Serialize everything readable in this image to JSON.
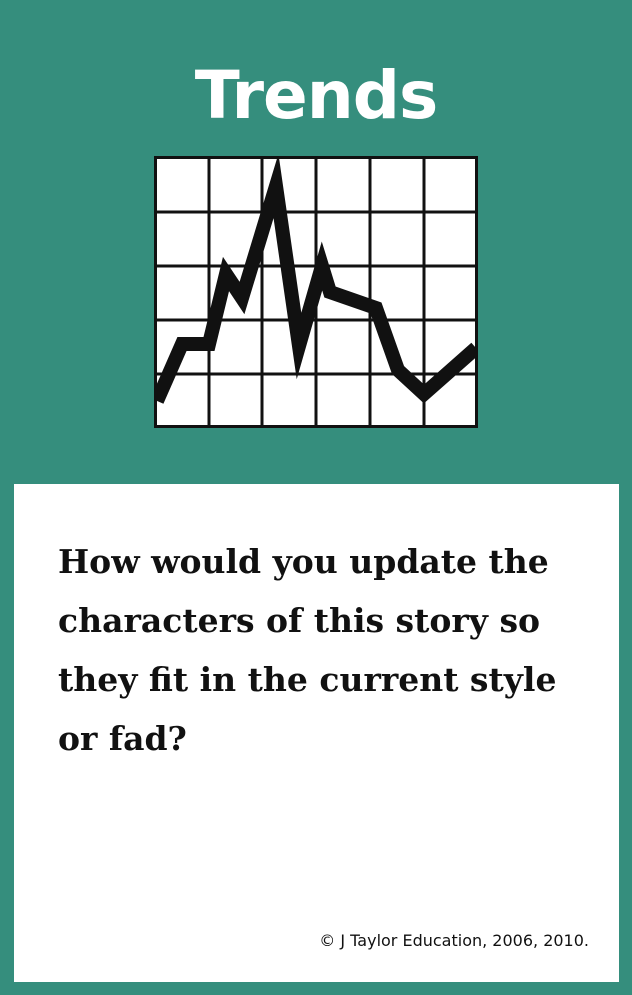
{
  "card": {
    "title": "Trends",
    "question": "How would you update the characters of this story so they fit in the current style or fad?",
    "copyright": "© J Taylor Education, 2006, 2010.",
    "colors": {
      "frame": "#358e7d",
      "panel": "#ffffff",
      "text": "#111111"
    },
    "icon": "line-chart-icon"
  }
}
